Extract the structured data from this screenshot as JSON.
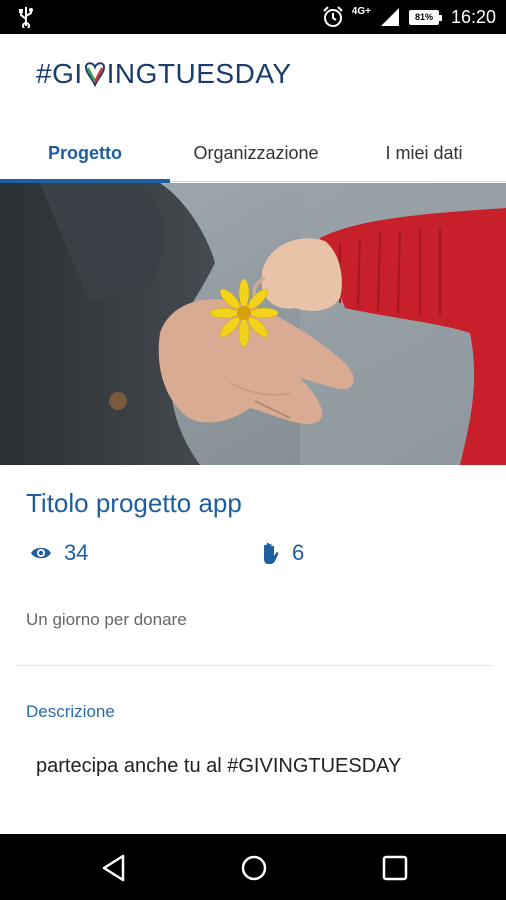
{
  "status_bar": {
    "time": "16:20",
    "network": "4G+",
    "battery": "81%",
    "icons": [
      "usb-icon",
      "alarm-icon",
      "signal-icon",
      "battery-icon"
    ]
  },
  "header": {
    "logo_text_1": "#GI",
    "logo_text_2": "INGTUESDAY",
    "logo_heart_icon": "heart-v-icon"
  },
  "tabs": [
    {
      "label": "Progetto",
      "active": true
    },
    {
      "label": "Organizzazione",
      "active": false
    },
    {
      "label": "I miei dati",
      "active": false
    }
  ],
  "hero": {
    "image": "child-hand-giving-yellow-flower-photo"
  },
  "project": {
    "title": "Titolo progetto app",
    "views": "34",
    "views_icon": "eye-icon",
    "supporters": "6",
    "supporters_icon": "hand-icon",
    "subtitle": "Un giorno per donare",
    "description_label": "Descrizione",
    "description": "partecipa anche tu al #GIVINGTUESDAY"
  },
  "nav": [
    "back-icon",
    "home-icon",
    "recents-icon"
  ],
  "colors": {
    "accent": "#1e5fa0",
    "logo": "#1b3c6e"
  }
}
